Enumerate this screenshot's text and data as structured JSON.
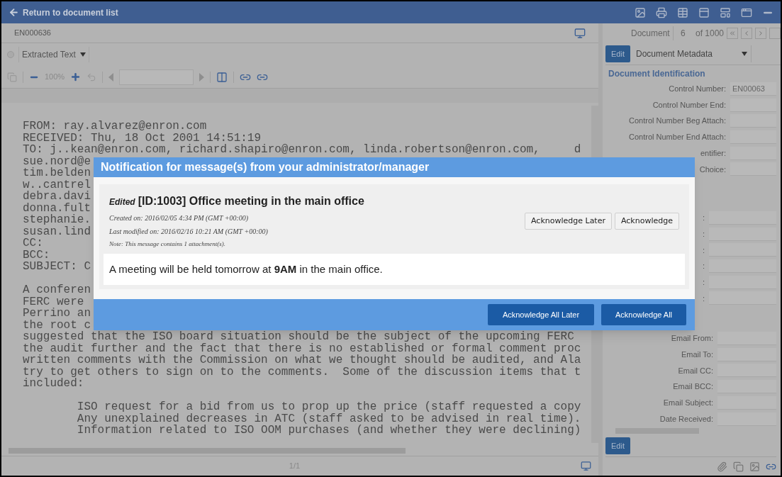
{
  "top_bar": {
    "back_link": "Return to document list"
  },
  "viewer": {
    "document_id": "EN000636",
    "view_mode": "Extracted Text",
    "zoom": "100%",
    "text_blocks": [
      [
        "FROM: ray.alvarez@enron.com",
        "RECEIVED: Thu, 18 Oct 2001 14:51:19",
        "TO: j..kean@enron.com, richard.shapiro@enron.com, linda.robertson@enron.com,     d",
        "sue.nord@e",
        "tim.belden",
        "w..cantrel",
        "debra.davi",
        "donna.fult",
        "stephanie.",
        "susan.lind",
        "CC:",
        "BCC:",
        "SUBJECT: C"
      ],
      [
        "A conferen",
        "FERC were",
        "Perrino an",
        "the root c",
        "suggested that the ISO board situation should be the subject of the upcoming FERC",
        "the audit further and the fact that there is no established or formal comment proc",
        "written comments with the Commission on what we thought should be audited, and Ala",
        "try to get others to sign on to the comments.  Some of the discussion items that t",
        "included:"
      ],
      [
        "        ISO request for a bid from us to prop up the price (staff requested a copy",
        "        Any unexplained decreases in ATC (staff asked to be advised in real time).",
        "        Information related to ISO OOM purchases (and whether they were declining)"
      ]
    ],
    "page_indicator": "1/1"
  },
  "metadata": {
    "document_label": "Document",
    "document_number": "6",
    "document_total": "of 1000",
    "edit_button": "Edit",
    "panel_select": "Document Metadata",
    "section_title": "Document Identification",
    "identification_fields": [
      {
        "label": "Control Number:",
        "value": "EN00063"
      },
      {
        "label": "Control Number End:"
      },
      {
        "label": "Control Number Beg Attach:"
      },
      {
        "label": "Control Number End Attach:"
      },
      {
        "label": "entifier:"
      },
      {
        "label": "Choice:"
      }
    ],
    "covered_fields": [
      {
        "label": ":"
      },
      {
        "label": ":"
      },
      {
        "label": ":"
      },
      {
        "label": ":"
      },
      {
        "label": ":"
      },
      {
        "label": ":"
      }
    ],
    "email_fields": [
      {
        "label": "Email From:"
      },
      {
        "label": "Email To:"
      },
      {
        "label": "Email CC:"
      },
      {
        "label": "Email BCC:"
      },
      {
        "label": "Email Subject:"
      },
      {
        "label": "Date Received:"
      }
    ],
    "bottom_edit": "Edit"
  },
  "notification": {
    "title": "Notification for message(s) from your administrator/manager",
    "messages": [
      {
        "edited_tag": "Edited",
        "subject": "[ID:1003] Office meeting in the main office",
        "created": "Created on: 2016/02/05 4:34 PM (GMT +00:00)",
        "modified": "Last modified on: 2016/02/16 10:21 AM (GMT +00:00)",
        "note": "Note: This message contains 1 attachment(s).",
        "body": "A meeting will be held tomorrow at **9AM** in the main office.",
        "buttons": [
          "Acknowledge Later",
          "Acknowledge"
        ]
      }
    ],
    "footer_buttons": [
      "Acknowledge All Later",
      "Acknowledge All"
    ]
  }
}
